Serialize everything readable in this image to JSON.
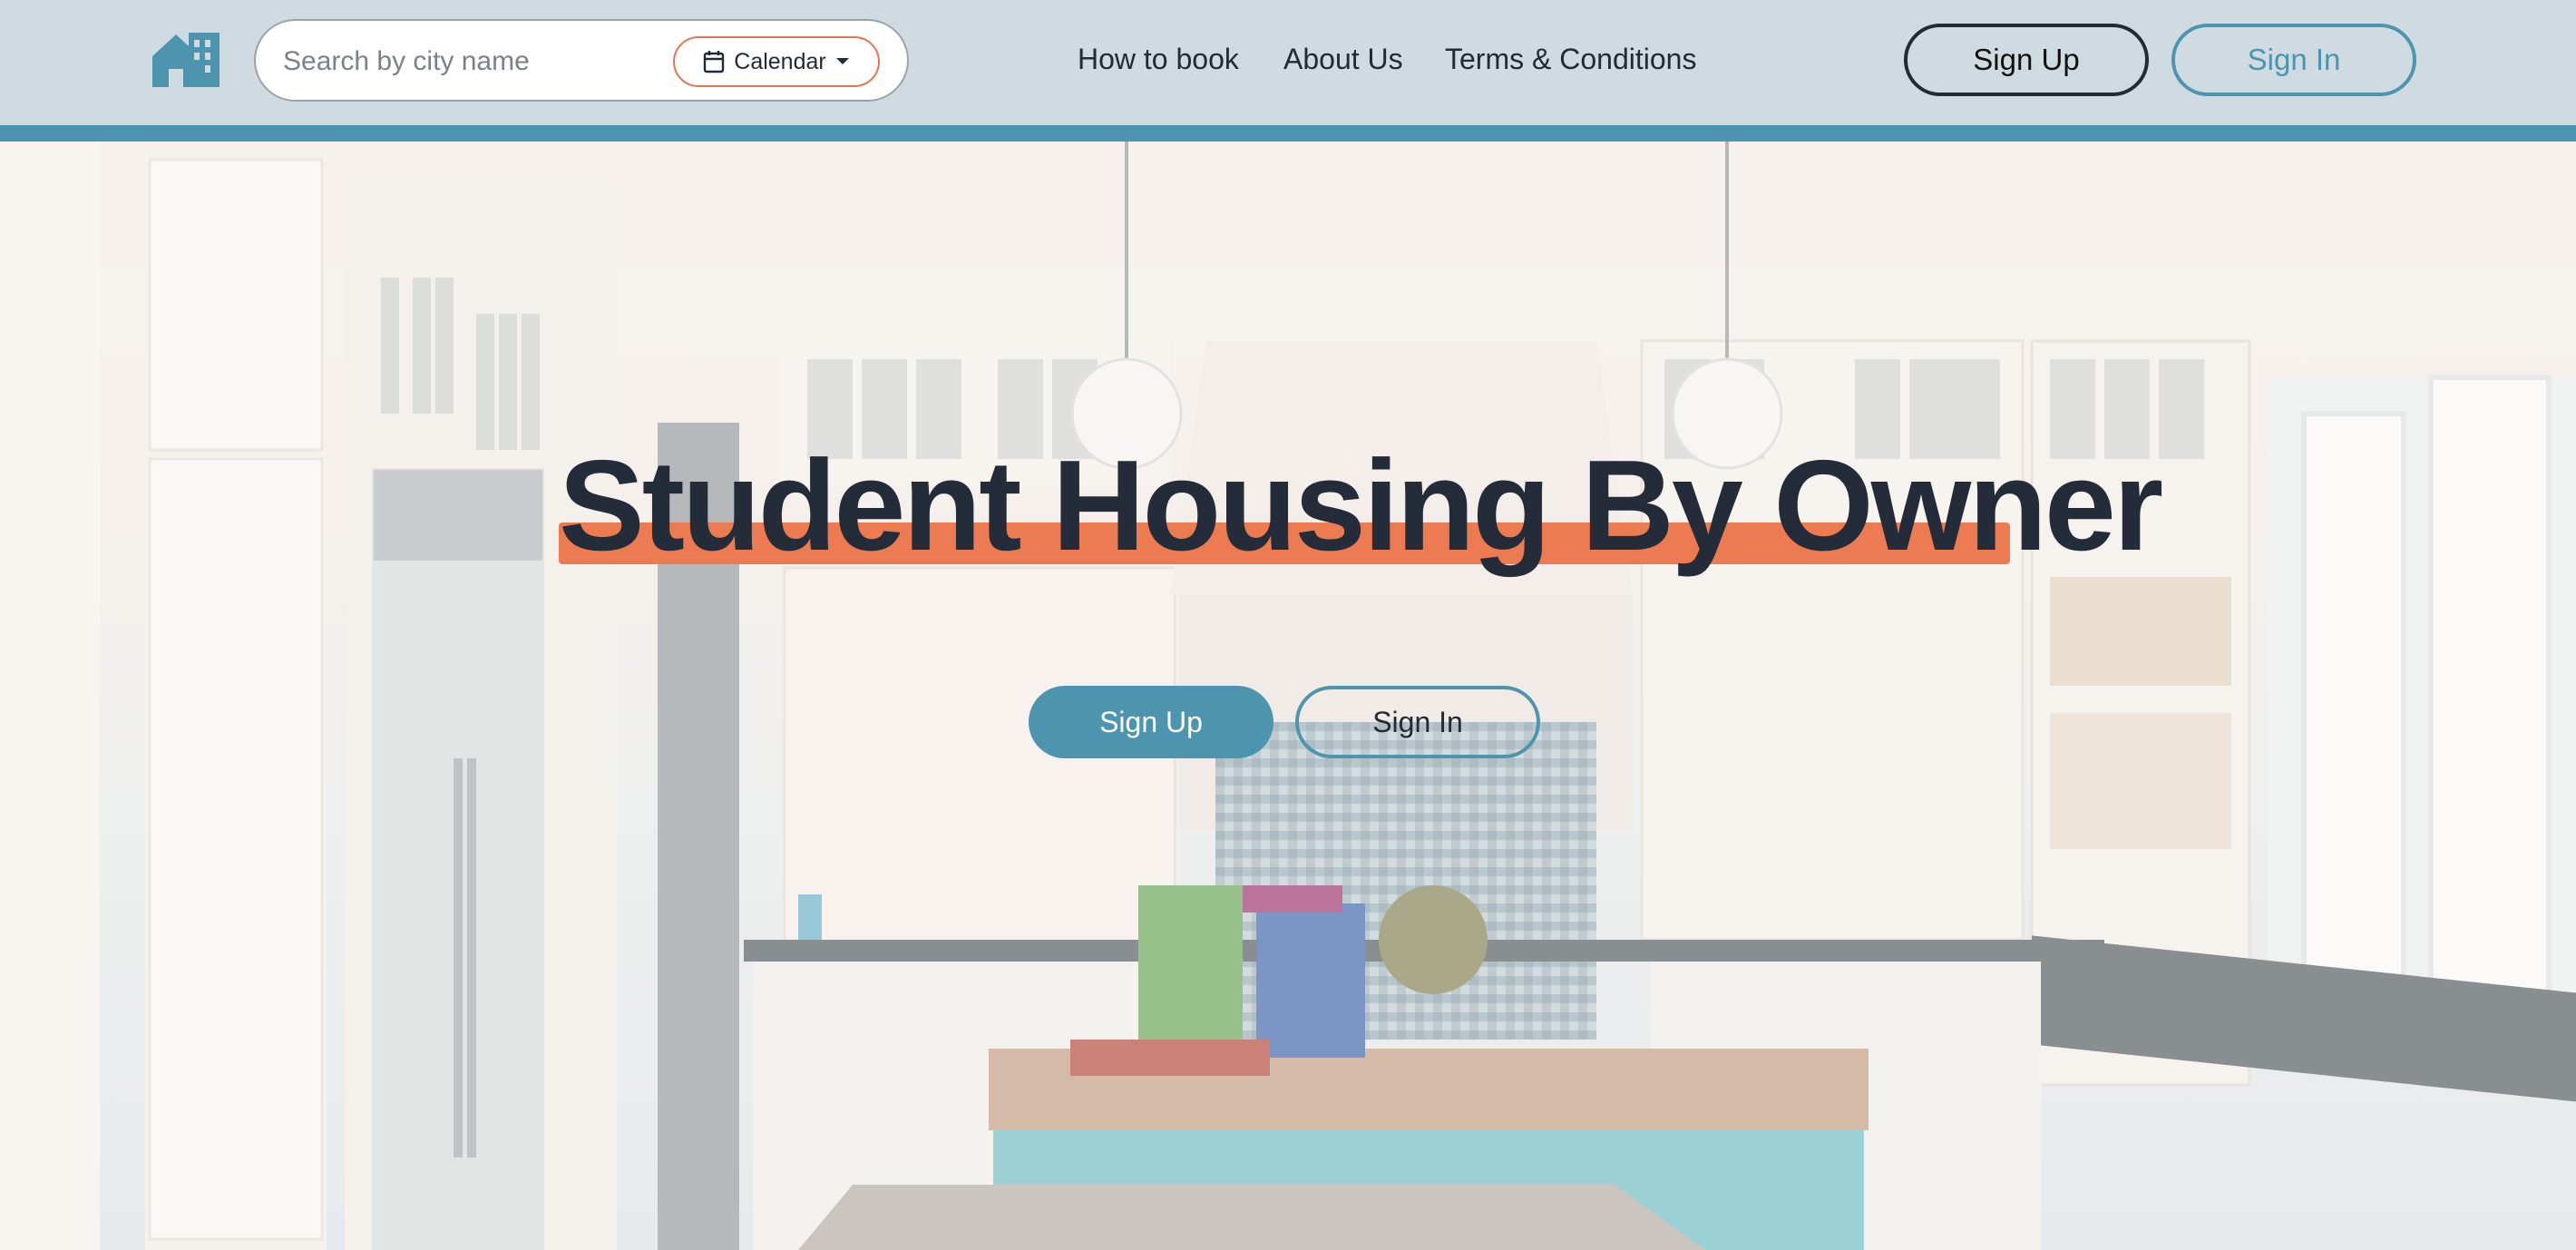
{
  "header": {
    "logo_icon": "house-logo-icon",
    "search": {
      "placeholder": "Search by city name",
      "value": ""
    },
    "calendar": {
      "label": "Calendar",
      "icon": "calendar-icon",
      "caret": "caret-down-icon"
    },
    "nav": [
      "How to book",
      "About Us",
      "Terms & Conditions"
    ],
    "sign_up_label": "Sign Up",
    "sign_in_label": "Sign In"
  },
  "hero": {
    "title": "Student Housing By Owner",
    "sign_up_label": "Sign Up",
    "sign_in_label": "Sign In",
    "background": "kitchen-photo"
  },
  "colors": {
    "header_bg": "#cfdbe1",
    "accent_teal": "#4d95ae",
    "accent_orange": "#ec7b52",
    "dark_text": "#232c38"
  }
}
